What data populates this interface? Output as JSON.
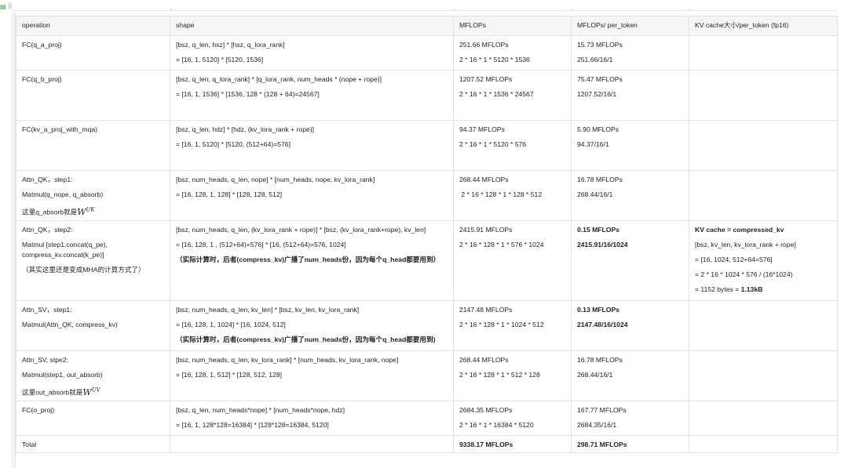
{
  "headers": [
    "operation",
    "shape",
    "MFLOPs",
    "MFLOPs/ per_token",
    "KV cache大小/per_token (fp16)"
  ],
  "rows": [
    {
      "op": [
        "FC(q_a_proj)"
      ],
      "shape": [
        "[bsz, q_len, hsz] * [hsz, q_lora_rank]",
        "= [16, 1, 5120] * [5120, 1536]"
      ],
      "mflops": [
        "251.66 MFLOPs",
        "2 * 16 * 1 * 5120 * 1536"
      ],
      "per_token": [
        "15.73 MFLOPs",
        "251.66/16/1"
      ],
      "kv": []
    },
    {
      "op": [
        "FC(q_b_proj)"
      ],
      "shape": [
        "[bsz, q_len, q_lora_rank] * [q_lora_rank, num_heads * (nope + rope)]",
        "= [16, 1, 1536] * [1536, 128 * (128 + 64)=24567]"
      ],
      "mflops": [
        "1207.52 MFLOPs",
        "2 * 16 * 1 * 1536 * 24567"
      ],
      "per_token": [
        "75.47 MFLOPs",
        "1207.52/16/1"
      ],
      "kv": []
    },
    {
      "op": [
        "FC(kv_a_proj_with_mqa)"
      ],
      "shape": [
        "[bsz, q_len, hdz] * [hdz, (kv_lora_rank + rope)]",
        "= [16, 1, 5120] * [5120, (512+64)=576]"
      ],
      "mflops": [
        "94.37 MFLOPs",
        "2 * 16 * 1 * 5120 * 576"
      ],
      "per_token": [
        "5.90 MFLOPs",
        "94.37/16/1"
      ],
      "kv": []
    },
    {
      "op": [
        "Attn_QK，step1:",
        "Matmul(q_nope, q_absorb)",
        "这里q_absorb就是"
      ],
      "op_math": {
        "base": "W",
        "sup": "UK"
      },
      "shape": [
        "[bsz, num_heads, q_len, nope] * [num_heads, nope, kv_lora_rank]",
        "= [16, 128, 1, 128] * [128, 128, 512]"
      ],
      "mflops": [
        "268.44 MFLOPs",
        " 2 * 16 * 128 * 1 * 128 * 512"
      ],
      "per_token": [
        "16.78 MFLOPs",
        "268.44/16/1"
      ],
      "kv": []
    },
    {
      "op": [
        "Attn_QK，step2:",
        "Matmul [step1.concat(q_pe),",
        "compress_kv.concat(k_pe)]",
        "（其实这里还是变成MHA的计算方式了）"
      ],
      "shape": [
        "[bsz, num_heads, q_len, (kv_lora_rank + rope)] * [bsz, (kv_lora_rank+rope), kv_len]",
        "= [16, 128, 1 , (512+64)=576] * [16, (512+64)=576, 1024]",
        "（实际计算时，后者(compress_kv)广播了num_heads份，因为每个q_head都要用到）"
      ],
      "mflops": [
        "2415.91 MFLOPs",
        "2 * 16 * 128 * 1 * 576 * 1024"
      ],
      "per_token": [
        "0.15 MFLOPs",
        "2415.91/16/1024"
      ],
      "kv": [
        "KV cache = compressed_kv",
        "[bsz, kv_len, kv_lora_rank + rope]",
        "= [16, 1024, 512+64=576]",
        "= 2 * 16 * 1024 * 576 / (16*1024)",
        "= 1152 bytes = ",
        "1.13kB"
      ]
    },
    {
      "op": [
        "Attn_SV，step1:",
        "Matmul(Attn_QK, compress_kv)"
      ],
      "shape": [
        "[bsz, num_heads, q_len, kv_len] * [bsz, kv_len, kv_lora_rank]",
        "= [16, 128, 1, 1024] * [16, 1024, 512]",
        "（实际计算时，后者(compress_kv)广播了num_heads份，因为每个q_head都要用到)"
      ],
      "mflops": [
        "2147.48 MFLOPs",
        "2 * 16 * 128 * 1 * 1024 * 512"
      ],
      "per_token": [
        "0.13 MFLOPs",
        "2147.48/16/1024"
      ],
      "kv": []
    },
    {
      "op": [
        "Attn_SV, stpe2:",
        "Matmul(step1, out_absorb)",
        "这里out_absorb就是"
      ],
      "op_math": {
        "base": "W",
        "sup": "UV"
      },
      "shape": [
        "[bsz, num_heads, q_len, kv_lora_rank] * [num_heads, kv_lora_rank, nope]",
        "= [16, 128, 1, 512] * [128, 512, 128]"
      ],
      "mflops": [
        "268.44 MFLOPs",
        "2 * 16 * 128 * 1 * 512 * 128"
      ],
      "per_token": [
        "16.78 MFLOPs",
        "268.44/16/1"
      ],
      "kv": []
    },
    {
      "op": [
        "FC(o_proj)"
      ],
      "shape": [
        "[bsz, q_len, num_heads*nope] * [num_heads*nope, hdz]",
        "= [16, 1, 128*128=16384] * [128*128=16384, 5120]"
      ],
      "mflops": [
        "2684.35 MFLOPs",
        "2 * 16 * 1 * 16384 * 5120"
      ],
      "per_token": [
        "167.77 MFLOPs",
        "2684.35/16/1"
      ],
      "kv": []
    },
    {
      "op": [
        "Total"
      ],
      "shape": [],
      "mflops": [
        "9338.17 MFLOPs"
      ],
      "per_token": [
        "298.71 MFLOPs"
      ],
      "kv": []
    }
  ],
  "ui": {
    "table_icon": "table-icon",
    "drag_handle_icon": "drag-handle-icon"
  }
}
